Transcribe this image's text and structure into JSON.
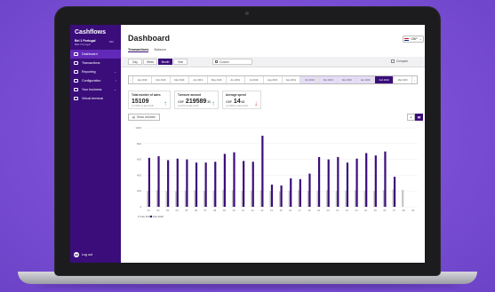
{
  "app": {
    "brand": "Cashflows",
    "merchant_name": "Bei 1 Portugal",
    "merchant_sub": "BE1 Portugal",
    "merchant_code": "BEI"
  },
  "sidebar": {
    "items": [
      {
        "label": "Dashboard",
        "icon": "dashboard-icon",
        "active": true,
        "chevron": ""
      },
      {
        "label": "Transactions",
        "icon": "transactions-icon",
        "active": false,
        "chevron": ""
      },
      {
        "label": "Reporting",
        "icon": "reporting-icon",
        "active": false,
        "chevron": "⌄"
      },
      {
        "label": "Configuration",
        "icon": "configuration-icon",
        "active": false,
        "chevron": "›"
      },
      {
        "label": "Your business",
        "icon": "business-icon",
        "active": false,
        "chevron": "⌄"
      },
      {
        "label": "Virtual terminal",
        "icon": "terminal-icon",
        "active": false,
        "chevron": ""
      }
    ],
    "logout_label": "Log out",
    "avatar_initials": "BEI"
  },
  "header": {
    "title": "Dashboard",
    "currency": "GBP"
  },
  "tabs": [
    {
      "label": "Transactions",
      "active": true
    },
    {
      "label": "Balance",
      "active": false
    }
  ],
  "periods": [
    {
      "label": "Day",
      "active": false
    },
    {
      "label": "Week",
      "active": false
    },
    {
      "label": "Month",
      "active": true
    },
    {
      "label": "Year",
      "active": false
    }
  ],
  "custom_label": "Custom",
  "compare_label": "Compare",
  "months": [
    "Jan 2019",
    "Feb 2019",
    "Mar 2019",
    "Apr 2019",
    "May 2019",
    "Jun 2019",
    "Jul 2019",
    "Aug 2019",
    "Sep 2019",
    "Oct 2019",
    "Nov 2019",
    "Dec 2019",
    "Jan 2020",
    "Feb 2020",
    "Mar 2020"
  ],
  "month_state": {
    "inrange": [
      9,
      10,
      11,
      12
    ],
    "active": 13
  },
  "cards": {
    "sales": {
      "label": "Total number of sales",
      "value": "15109",
      "sub": "vs 0.00% on last month",
      "trend": "up"
    },
    "amount": {
      "label": "Turnover amount",
      "currency": "GBP",
      "value": "219589",
      "decimals": ".35",
      "sub": "vs 9.2% on last month",
      "trend": "up"
    },
    "avg": {
      "label": "Average spend",
      "currency": "GBP",
      "value": "14",
      "decimals": ".68",
      "sub": "vs 0.00% on last month",
      "trend": "down"
    }
  },
  "show_volumes_label": "Show volumes",
  "view_toggle": [
    {
      "label": "£",
      "active": false
    },
    {
      "label": "▮▮",
      "active": true
    }
  ],
  "chart_data": {
    "type": "bar",
    "categories": [
      "01",
      "02",
      "03",
      "04",
      "05",
      "06",
      "07",
      "08",
      "09",
      "10",
      "11",
      "12",
      "13",
      "14",
      "15",
      "16",
      "17",
      "18",
      "19",
      "20",
      "21",
      "22",
      "23",
      "24",
      "25",
      "26",
      "27",
      "28",
      "29"
    ],
    "series": [
      {
        "name": "Feb 2020",
        "color": "#3a0d7a",
        "values": [
          620,
          640,
          590,
          610,
          600,
          560,
          560,
          570,
          670,
          690,
          580,
          570,
          900,
          280,
          270,
          360,
          350,
          420,
          630,
          600,
          630,
          560,
          610,
          680,
          650,
          700,
          380,
          0,
          0
        ]
      },
      {
        "name": "Feb 2019",
        "color": "#c7c7c7",
        "values": [
          200,
          210,
          200,
          195,
          205,
          210,
          200,
          205,
          215,
          210,
          200,
          205,
          210,
          200,
          195,
          205,
          210,
          200,
          205,
          210,
          200,
          205,
          210,
          205,
          200,
          210,
          220,
          215,
          0
        ]
      }
    ],
    "ylim": [
      0,
      1000
    ],
    "yticks": [
      0,
      200,
      400,
      600,
      800,
      1000
    ],
    "legend_position": "bottom-left"
  }
}
